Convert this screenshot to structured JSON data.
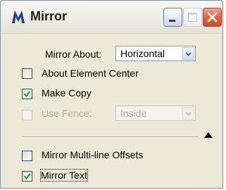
{
  "window": {
    "title": "Mirror",
    "icon": "mirror-tool-icon",
    "controls": [
      "minimize-icon",
      "maximize-icon",
      "close-icon"
    ]
  },
  "mirror_about": {
    "label": "Mirror About:",
    "value": "Horizontal"
  },
  "about_element_center": {
    "label": "About Element Center",
    "checked": false
  },
  "make_copy": {
    "label": "Make Copy",
    "checked": true
  },
  "use_fence": {
    "label": "Use Fence:",
    "checked": false,
    "enabled": false,
    "value": "Inside"
  },
  "mirror_multiline_offsets": {
    "label": "Mirror Multi-line Offsets",
    "checked": false
  },
  "mirror_text": {
    "label": "Mirror Text",
    "checked": true
  },
  "colors": {
    "accent": "#1c5180",
    "check": "#21a121",
    "close": "#e2613f"
  }
}
